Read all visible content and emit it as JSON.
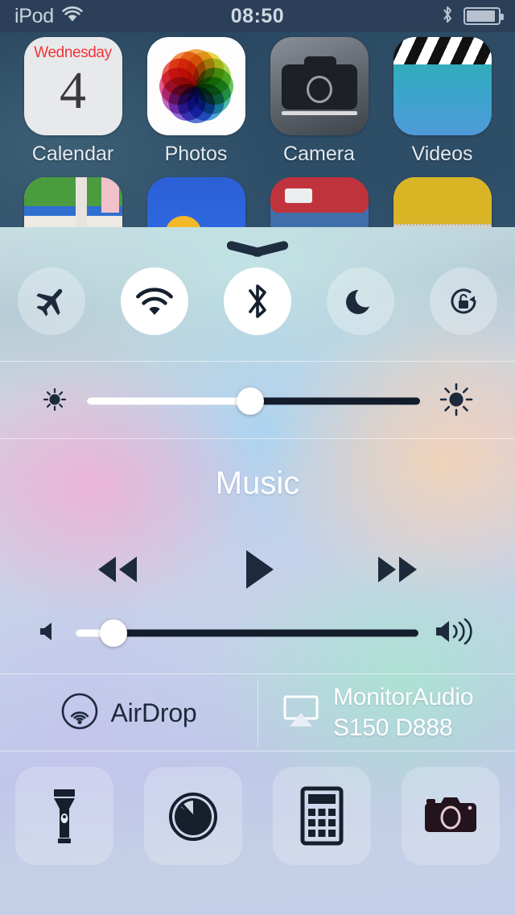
{
  "status_bar": {
    "carrier": "iPod",
    "wifi_icon": "wifi-icon",
    "time": "08:50",
    "bluetooth_icon": "bluetooth-icon",
    "battery_icon": "battery-icon",
    "battery_level_percent": 92,
    "background_color": "#2b4058",
    "text_color": "#c9d4de"
  },
  "home_screen": {
    "apps": [
      {
        "label": "Calendar",
        "icon": "calendar-icon",
        "weekday": "Wednesday",
        "day": "4"
      },
      {
        "label": "Photos",
        "icon": "photos-icon"
      },
      {
        "label": "Camera",
        "icon": "camera-icon"
      },
      {
        "label": "Videos",
        "icon": "videos-icon"
      }
    ],
    "second_row_icons": [
      "maps-icon",
      "weather-icon",
      "passbook-icon",
      "notes-icon"
    ]
  },
  "control_center": {
    "grabber": "grabber-handle",
    "toggles": [
      {
        "name": "airplane-mode",
        "icon": "airplane-icon",
        "state": "off"
      },
      {
        "name": "wifi",
        "icon": "wifi-icon",
        "state": "on"
      },
      {
        "name": "bluetooth",
        "icon": "bluetooth-icon",
        "state": "on"
      },
      {
        "name": "do-not-disturb",
        "icon": "moon-icon",
        "state": "off"
      },
      {
        "name": "rotation-lock",
        "icon": "rotation-lock-icon",
        "state": "off"
      }
    ],
    "brightness": {
      "low_icon": "brightness-low-icon",
      "high_icon": "brightness-high-icon",
      "value_percent": 49
    },
    "music": {
      "title": "Music",
      "previous_label": "rewind-icon",
      "play_label": "play-icon",
      "next_label": "fast-forward-icon"
    },
    "volume": {
      "low_icon": "volume-low-icon",
      "high_icon": "volume-high-icon",
      "value_percent": 11
    },
    "airdrop": {
      "icon": "airdrop-icon",
      "label": "AirDrop"
    },
    "airplay": {
      "icon": "airplay-icon",
      "label": "MonitorAudio S150 D888"
    },
    "shortcuts": [
      {
        "name": "flashlight",
        "icon": "flashlight-icon"
      },
      {
        "name": "timer",
        "icon": "timer-icon"
      },
      {
        "name": "calculator",
        "icon": "calculator-icon"
      },
      {
        "name": "camera",
        "icon": "camera-icon"
      }
    ],
    "colors": {
      "icon_dark": "#1c2a3c",
      "toggle_on_bg": "#ffffff",
      "toggle_off_bg": "rgba(255,255,255,0.30)",
      "track_dark": "#131c2b",
      "track_fill": "#ffffff"
    }
  }
}
